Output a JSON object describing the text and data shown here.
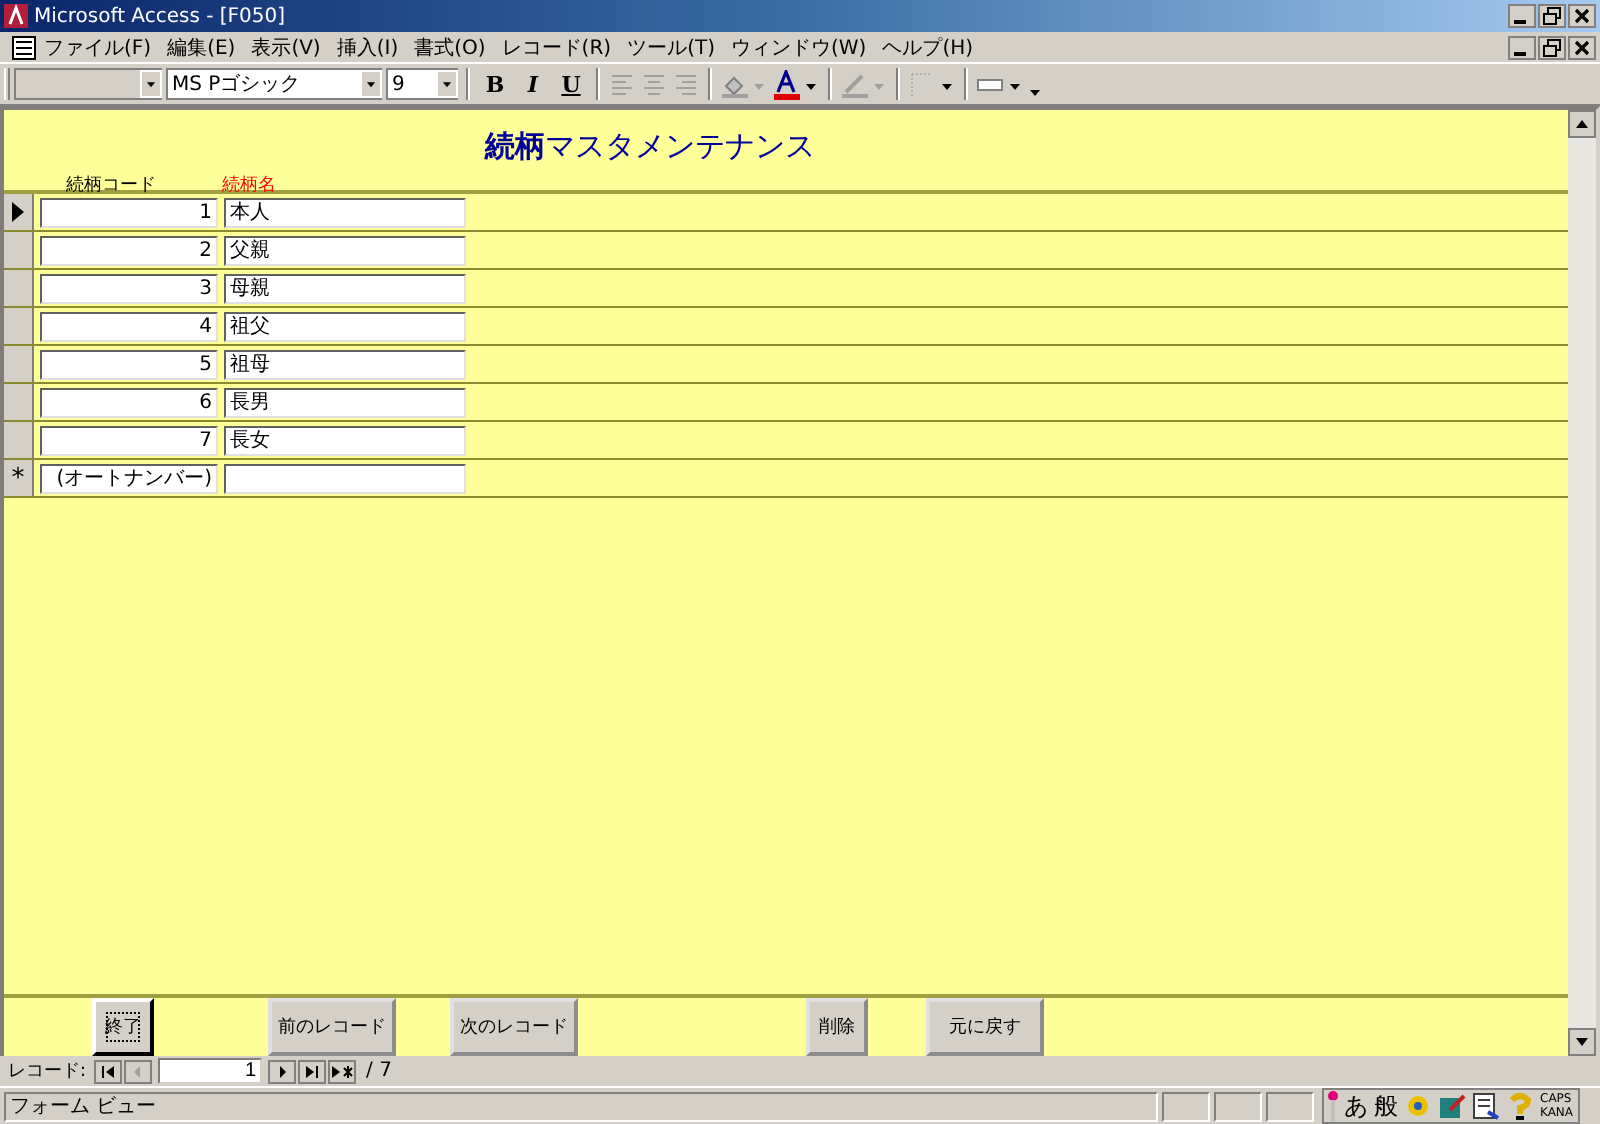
{
  "window": {
    "title": "Microsoft Access - [F050]"
  },
  "menu": [
    "ファイル(F)",
    "編集(E)",
    "表示(V)",
    "挿入(I)",
    "書式(O)",
    "レコード(R)",
    "ツール(T)",
    "ウィンドウ(W)",
    "ヘルプ(H)"
  ],
  "toolbar": {
    "font_name": "MS Pゴシック",
    "font_size": "9",
    "styles": [
      {
        "label": "B",
        "kind": "bold"
      },
      {
        "label": "I",
        "kind": "italic"
      },
      {
        "label": "U",
        "kind": "underline"
      }
    ]
  },
  "form": {
    "title": "**続柄**マスタメンテナンス",
    "columns": [
      {
        "label": "続柄コード",
        "color": "#000000"
      },
      {
        "label": "続柄名",
        "color": "#ff0000"
      }
    ],
    "rows": [
      {
        "code": "1",
        "name": "本人",
        "selected": true
      },
      {
        "code": "2",
        "name": "父親",
        "selected": false
      },
      {
        "code": "3",
        "name": "母親",
        "selected": false
      },
      {
        "code": "4",
        "name": "祖父",
        "selected": false
      },
      {
        "code": "5",
        "name": "祖母",
        "selected": false
      },
      {
        "code": "6",
        "name": "長男",
        "selected": false
      },
      {
        "code": "7",
        "name": "長女",
        "selected": false
      }
    ],
    "new_row": {
      "marker": "*",
      "placeholder": "(オートナンバー)"
    },
    "buttons": [
      {
        "label": "終了",
        "focused": true
      },
      {
        "label": "前のレコード",
        "focused": false
      },
      {
        "label": "次のレコード",
        "focused": false
      },
      {
        "label": "削除",
        "focused": false
      },
      {
        "label": "元に戻す",
        "focused": false
      }
    ]
  },
  "navigation": {
    "label": "レコード:",
    "current": "1",
    "total": "/ 7"
  },
  "status_bar": {
    "text": "フォーム ビュー",
    "ime": [
      "あ",
      "般"
    ],
    "caps": "CAPS",
    "kana": "KANA"
  }
}
